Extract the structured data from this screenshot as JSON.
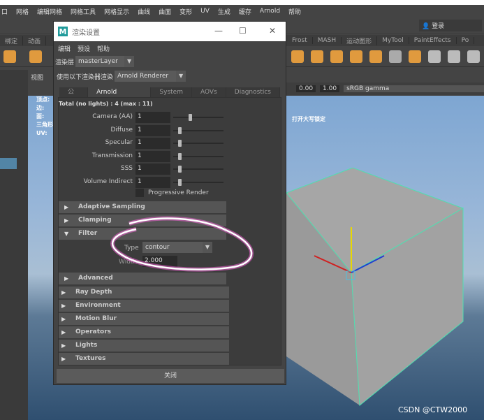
{
  "menubar": {
    "items": [
      "口",
      "网格",
      "编辑网格",
      "网格工具",
      "网格显示",
      "曲线",
      "曲面",
      "变形",
      "UV",
      "生成",
      "缓存",
      "Arnold",
      "帮助"
    ]
  },
  "login": "登录",
  "shelf_tabs": [
    "绑定",
    "动画",
    "",
    "",
    "",
    "",
    "",
    "",
    "Frost",
    "MASH",
    "运动图形",
    "MyTool",
    "PaintEffects",
    "Po"
  ],
  "panel": {
    "view_menu": "视图",
    "hud": [
      "顶点:",
      "边:",
      "面:",
      "三角形",
      "UV:"
    ],
    "caps_message": "打开大写锁定",
    "exposure": "0.00",
    "gamma": "1.00",
    "color_space": "sRGB gamma"
  },
  "dialog": {
    "title": "渲染设置",
    "menu": [
      "编辑",
      "预设",
      "帮助"
    ],
    "render_layer_label": "渲染层",
    "render_layer": "masterLayer",
    "renderer_label": "使用以下渲染器渲染",
    "renderer": "Arnold Renderer",
    "tabs": [
      "公用",
      "Arnold Renderer",
      "System",
      "AOVs",
      "Diagnostics"
    ],
    "active_tab": "Arnold Renderer",
    "total": "Total (no lights) : 4 (max : 11)",
    "samples": [
      {
        "label": "Camera (AA)",
        "value": "1",
        "slider": 0.3
      },
      {
        "label": "Diffuse",
        "value": "1",
        "slider": 0.1
      },
      {
        "label": "Specular",
        "value": "1",
        "slider": 0.1
      },
      {
        "label": "Transmission",
        "value": "1",
        "slider": 0.1
      },
      {
        "label": "SSS",
        "value": "1",
        "slider": 0.1
      },
      {
        "label": "Volume Indirect",
        "value": "1",
        "slider": 0.1
      }
    ],
    "progressive_render": "Progressive Render",
    "subsections": [
      "Adaptive Sampling",
      "Clamping",
      "Filter"
    ],
    "filter": {
      "type_label": "Type",
      "type": "contour",
      "width_label": "Width",
      "width": "2.000"
    },
    "advanced": "Advanced",
    "sections": [
      "Ray Depth",
      "Environment",
      "Motion Blur",
      "Operators",
      "Lights",
      "Textures"
    ],
    "close": "关闭"
  },
  "watermark": "CSDN @CTW2000"
}
